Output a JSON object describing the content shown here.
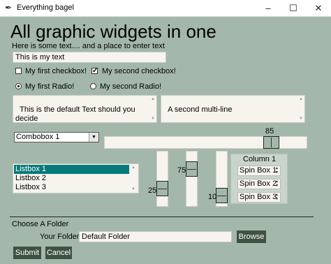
{
  "window": {
    "title": "Everything bagel",
    "app_icon": "feather-icon",
    "controls": {
      "minimize": "–",
      "maximize": "☐",
      "close": "✕"
    }
  },
  "colors": {
    "background": "#a3b8aa",
    "field_background": "#f7f4ee",
    "button_background": "#3f5241",
    "listbox_selection": "#067a7a"
  },
  "main": {
    "heading": "All graphic widgets in one",
    "subtext": "Here is some text.... and a place to enter text",
    "text_entry_value": "This is my text",
    "checkboxes": [
      {
        "label": "My first checkbox!",
        "checked": false
      },
      {
        "label": "My second checkbox!",
        "checked": true
      }
    ],
    "radios": [
      {
        "label": "My first Radio!",
        "selected": true
      },
      {
        "label": "My second Radio!",
        "selected": false
      }
    ],
    "multiline_1": "This is the default Text should you decide\nnot to type anything",
    "multiline_2": "A second multi-line",
    "combobox_value": "Combobox 1",
    "slider_h_value": "85",
    "listbox_items": [
      "Listbox 1",
      "Listbox 2",
      "Listbox 3"
    ],
    "listbox_selected_index": 0,
    "vertical_sliders": [
      "25",
      "75",
      "10"
    ],
    "column": {
      "title": "Column 1",
      "spinboxes": [
        "Spin Box 1",
        "Spin Box 2",
        "Spin Box 3"
      ]
    }
  },
  "folder": {
    "section_label": "Choose A Folder",
    "field_label": "Your Folder",
    "field_value": "Default Folder",
    "browse_label": "Browse"
  },
  "buttons": {
    "submit_label": "Submit",
    "cancel_label": "Cancel"
  }
}
